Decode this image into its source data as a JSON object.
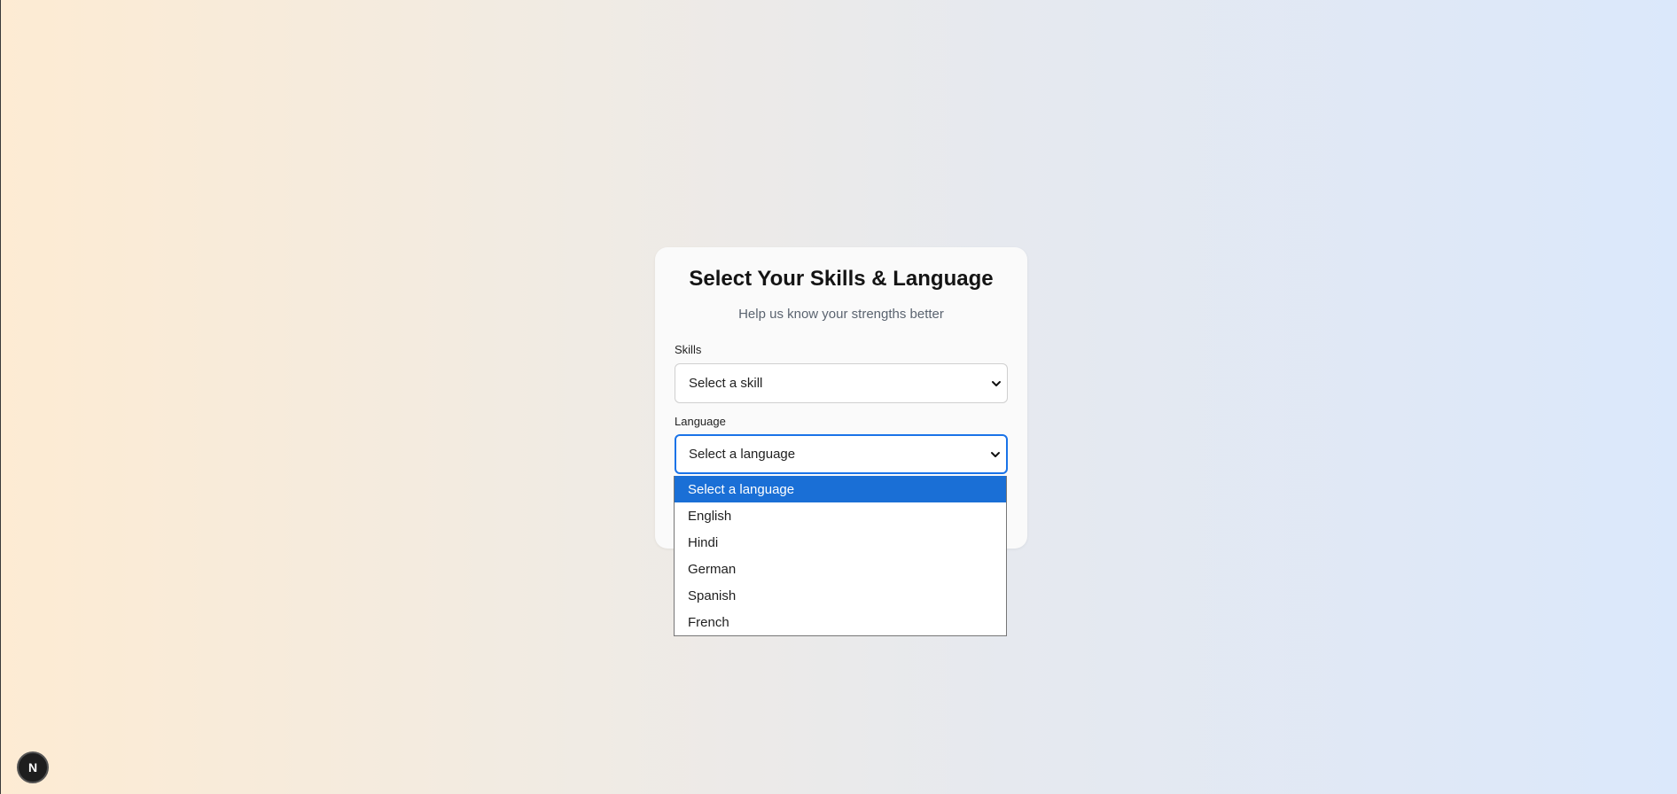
{
  "card": {
    "title": "Select Your Skills & Language",
    "subtitle": "Help us know your strengths better"
  },
  "skills": {
    "label": "Skills",
    "selected_value": "Select a skill"
  },
  "language": {
    "label": "Language",
    "selected_value": "Select a language",
    "options": [
      "Select a language",
      "English",
      "Hindi",
      "German",
      "Spanish",
      "French"
    ],
    "highlighted_index": 0
  },
  "dev_badge": {
    "letter": "N",
    "icon": "nextjs-icon"
  },
  "colors": {
    "accent": "#1a6fd6",
    "focus_border": "#1a73e8",
    "card_bg": "#fafafa"
  }
}
